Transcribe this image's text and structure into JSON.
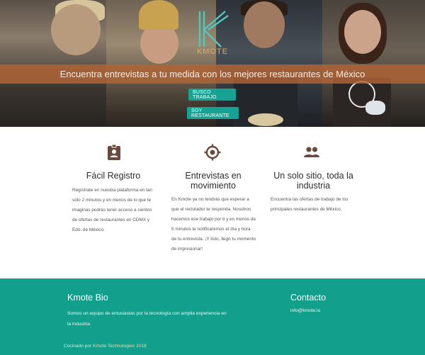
{
  "hero": {
    "logo_text": "KMOTE",
    "tagline": "Encuentra entrevistas a tu medida con los mejores restaurantes de México",
    "buttons": {
      "busco_trabajo": "BUSCO TRABAJO",
      "soy_restaurante": "SOY RESTAURANTE"
    }
  },
  "features": [
    {
      "icon": "clipboard-user-icon",
      "title": "Fácil Registro",
      "body": "Regístrate en nuestra plataforma en tan sólo 2 minutos y en menos de lo que te imaginas podrás tener acceso a cientos de ofertas de restaurantes en CDMX y Edo. de México."
    },
    {
      "icon": "crosshair-icon",
      "title": "Entrevistas en movimiento",
      "body": "En Kmote ya no tendrás que esperar a que el reclutador te responda. Nosotros hacemos ese trabajo por ti y en menos de 5 minutos te notificaremos el día y hora de tu entrevista. ¡Y listo, llegó tu momento de impresionar!"
    },
    {
      "icon": "people-icon",
      "title": "Un solo sitio, toda la industria",
      "body": "Encuentra las ofertas de trabajo de los principales restaurantes de México."
    }
  ],
  "footer": {
    "bio_title": "Kmote Bio",
    "bio_text": "Somos un equipo de entusiastas por la tecnología con amplia experiencia en la industria.",
    "contact_title": "Contacto",
    "contact_email": "info@kmote.io",
    "credit_prefix": "Cocinado por",
    "credit_link": "Kmote Technologies 2018"
  },
  "colors": {
    "accent": "#16a394",
    "footer_bg": "#12a08c",
    "tagline_bar": "#b26434",
    "icon": "#6b4a3e",
    "logo": "#e3a85d"
  }
}
